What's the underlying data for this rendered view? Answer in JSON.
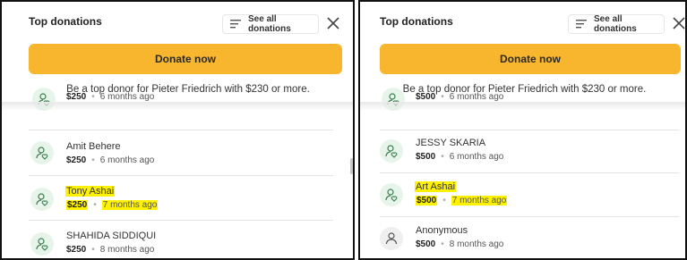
{
  "colors": {
    "accent": "#f8b52e",
    "highlight": "#fff200",
    "avatar_green": "#e7f4ea",
    "avatar_grey": "#efefef"
  },
  "panels": [
    {
      "title": "Top donations",
      "see_all_label": "See all donations",
      "donate_label": "Donate now",
      "prompt": "Be a top donor for Pieter Friedrich with $230 or more.",
      "donations": [
        {
          "name": "",
          "amount": "$250",
          "time": "6 months ago",
          "highlighted": false,
          "avatar": "person-heart-icon"
        },
        {
          "name": "Amit Behere",
          "amount": "$250",
          "time": "6 months ago",
          "highlighted": false,
          "avatar": "person-heart-icon"
        },
        {
          "name": "Tony Ashai",
          "amount": "$250",
          "time": "7 months ago",
          "highlighted": true,
          "avatar": "person-heart-icon"
        },
        {
          "name": "SHAHIDA SIDDIQUI",
          "amount": "$250",
          "time": "8 months ago",
          "highlighted": false,
          "avatar": "person-heart-icon"
        }
      ]
    },
    {
      "title": "Top donations",
      "see_all_label": "See all donations",
      "donate_label": "Donate now",
      "prompt": "Be a top donor for Pieter Friedrich with $230 or more.",
      "donations": [
        {
          "name": "",
          "amount": "$500",
          "time": "6 months ago",
          "highlighted": false,
          "avatar": "person-heart-icon"
        },
        {
          "name": "JESSY SKARIA",
          "amount": "$500",
          "time": "6 months ago",
          "highlighted": false,
          "avatar": "person-heart-icon"
        },
        {
          "name": "Art Ashai",
          "amount": "$500",
          "time": "7 months ago",
          "highlighted": true,
          "avatar": "person-heart-icon"
        },
        {
          "name": "Anonymous",
          "amount": "$500",
          "time": "8 months ago",
          "highlighted": false,
          "avatar": "person-icon"
        }
      ]
    }
  ]
}
